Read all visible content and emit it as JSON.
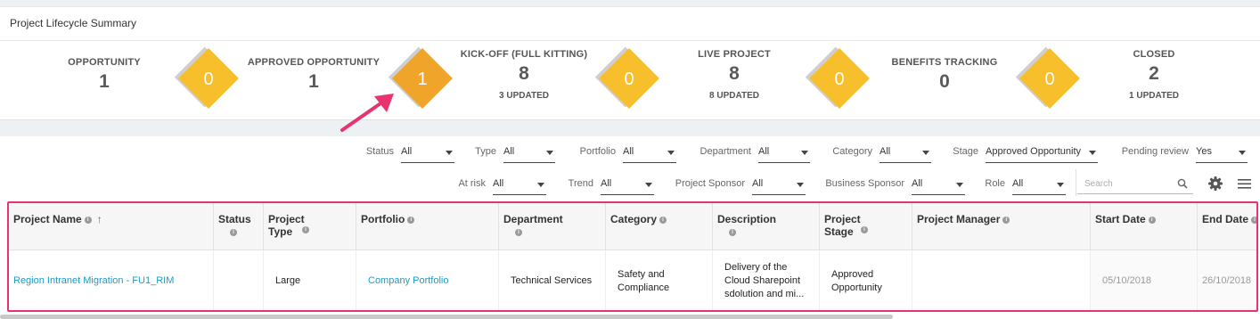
{
  "summary": {
    "title": "Project Lifecycle Summary",
    "stages": [
      {
        "label": "OPPORTUNITY",
        "count": "1",
        "updated": ""
      },
      {
        "label": "APPROVED OPPORTUNITY",
        "count": "1",
        "updated": ""
      },
      {
        "label": "KICK-OFF (FULL KITTING)",
        "count": "8",
        "updated": "3 UPDATED"
      },
      {
        "label": "LIVE PROJECT",
        "count": "8",
        "updated": "8 UPDATED"
      },
      {
        "label": "BENEFITS TRACKING",
        "count": "0",
        "updated": ""
      },
      {
        "label": "CLOSED",
        "count": "2",
        "updated": "1 UPDATED"
      }
    ],
    "transitions": [
      "0",
      "1",
      "0",
      "0",
      "0"
    ]
  },
  "filters": {
    "status": {
      "label": "Status",
      "value": "All"
    },
    "type": {
      "label": "Type",
      "value": "All"
    },
    "portfolio": {
      "label": "Portfolio",
      "value": "All"
    },
    "department": {
      "label": "Department",
      "value": "All"
    },
    "category": {
      "label": "Category",
      "value": "All"
    },
    "stage": {
      "label": "Stage",
      "value": "Approved Opportunity"
    },
    "pending_review": {
      "label": "Pending review",
      "value": "Yes"
    },
    "at_risk": {
      "label": "At risk",
      "value": "All"
    },
    "trend": {
      "label": "Trend",
      "value": "All"
    },
    "project_sponsor": {
      "label": "Project Sponsor",
      "value": "All"
    },
    "business_sponsor": {
      "label": "Business Sponsor",
      "value": "All"
    },
    "role": {
      "label": "Role",
      "value": "All"
    },
    "search_placeholder": "Search"
  },
  "table": {
    "columns": [
      "Project Name",
      "Status",
      "Project\nType",
      "Portfolio",
      "Department",
      "Category",
      "Description",
      "Project\nStage",
      "Project Manager",
      "Start Date",
      "End Date"
    ],
    "row": [
      "Region Intranet Migration - FU1_RIM",
      "",
      "Large",
      "Company Portfolio",
      "Technical Services",
      "Safety and Compliance",
      "Delivery of the Cloud Sharepoint sdolution and mi...",
      "Approved Opportunity",
      "",
      "05/10/2018",
      "26/10/2018"
    ]
  },
  "colors": {
    "diamond": "#f7bf2c",
    "diamond_active": "#f0a42a",
    "highlight": "#e8336d",
    "link": "#1b9bc8"
  }
}
